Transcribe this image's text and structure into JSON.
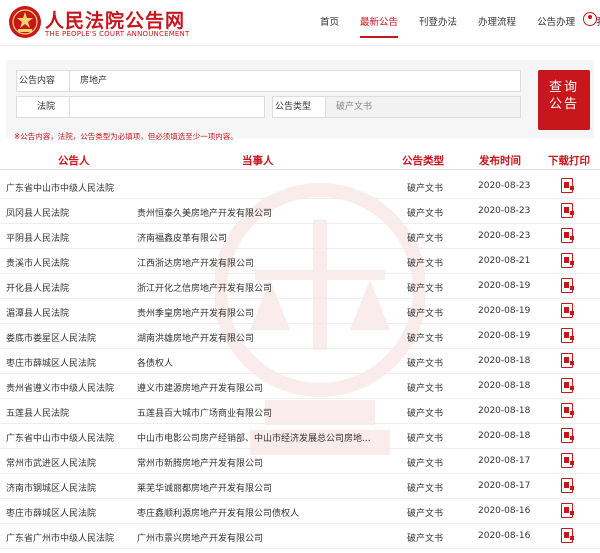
{
  "brand": {
    "name_cn": "人民法院公告网",
    "name_en": "THE PEOPLE'S COURT ANNOUNCEMENT"
  },
  "nav": [
    {
      "label": "首页",
      "active": false
    },
    {
      "label": "最新公告",
      "active": true
    },
    {
      "label": "刊登办法",
      "active": false
    },
    {
      "label": "办理流程",
      "active": false
    },
    {
      "label": "公告办理",
      "active": false
    },
    {
      "label": "我的",
      "active": false
    }
  ],
  "search": {
    "content_label": "公告内容",
    "content_value": "房地产",
    "court_label": "法院",
    "court_value": "",
    "type_label": "公告类型",
    "type_value": "破产文书",
    "button_label_1": "查询",
    "button_label_2": "公告",
    "hint": "※公告内容，法院，公告类型为必填项，但必须填选至少一项内容。"
  },
  "table": {
    "headers": {
      "court": "公告人",
      "party": "当事人",
      "type": "公告类型",
      "date": "发布时间",
      "download": "下载打印"
    },
    "rows": [
      {
        "court": "广东省中山市中级人民法院",
        "party": "",
        "type": "破产文书",
        "date": "2020-08-23"
      },
      {
        "court": "凤冈县人民法院",
        "party": "贵州恒泰久美房地产开发有限公司",
        "type": "破产文书",
        "date": "2020-08-23"
      },
      {
        "court": "平阴县人民法院",
        "party": "济南福鑫皮革有限公司",
        "type": "破产文书",
        "date": "2020-08-23"
      },
      {
        "court": "贵溪市人民法院",
        "party": "江西浙达房地产开发有限公司",
        "type": "破产文书",
        "date": "2020-08-21"
      },
      {
        "court": "开化县人民法院",
        "party": "浙江开化之信房地产开发有限公司",
        "type": "破产文书",
        "date": "2020-08-19"
      },
      {
        "court": "湄潭县人民法院",
        "party": "贵州季皇房地产开发有限公司",
        "type": "破产文书",
        "date": "2020-08-19"
      },
      {
        "court": "娄底市娄星区人民法院",
        "party": "湖南洪雄房地产开发有限公司",
        "type": "破产文书",
        "date": "2020-08-19"
      },
      {
        "court": "枣庄市薛城区人民法院",
        "party": "各债权人",
        "type": "破产文书",
        "date": "2020-08-18"
      },
      {
        "court": "贵州省遵义市中级人民法院",
        "party": "遵义市建源房地产开发有限公司",
        "type": "破产文书",
        "date": "2020-08-18"
      },
      {
        "court": "五莲县人民法院",
        "party": "五莲县百大城市广场商业有限公司",
        "type": "破产文书",
        "date": "2020-08-18"
      },
      {
        "court": "广东省中山市中级人民法院",
        "party": "中山市电影公司房产经销部、中山市经济发展总公司房地...",
        "type": "破产文书",
        "date": "2020-08-18"
      },
      {
        "court": "常州市武进区人民法院",
        "party": "常州市新腾房地产开发有限公司",
        "type": "破产文书",
        "date": "2020-08-17"
      },
      {
        "court": "济南市钢城区人民法院",
        "party": "莱芜华诚丽都房地产开发有限公司",
        "type": "破产文书",
        "date": "2020-08-17"
      },
      {
        "court": "枣庄市薛城区人民法院",
        "party": "枣庄鑫顺利源房地产开发有限公司债权人",
        "type": "破产文书",
        "date": "2020-08-16"
      },
      {
        "court": "广东省广州市中级人民法院",
        "party": "广州市景兴房地产开发有限公司",
        "type": "破产文书",
        "date": "2020-08-16"
      }
    ]
  },
  "colors": {
    "accent": "#c8161d"
  }
}
